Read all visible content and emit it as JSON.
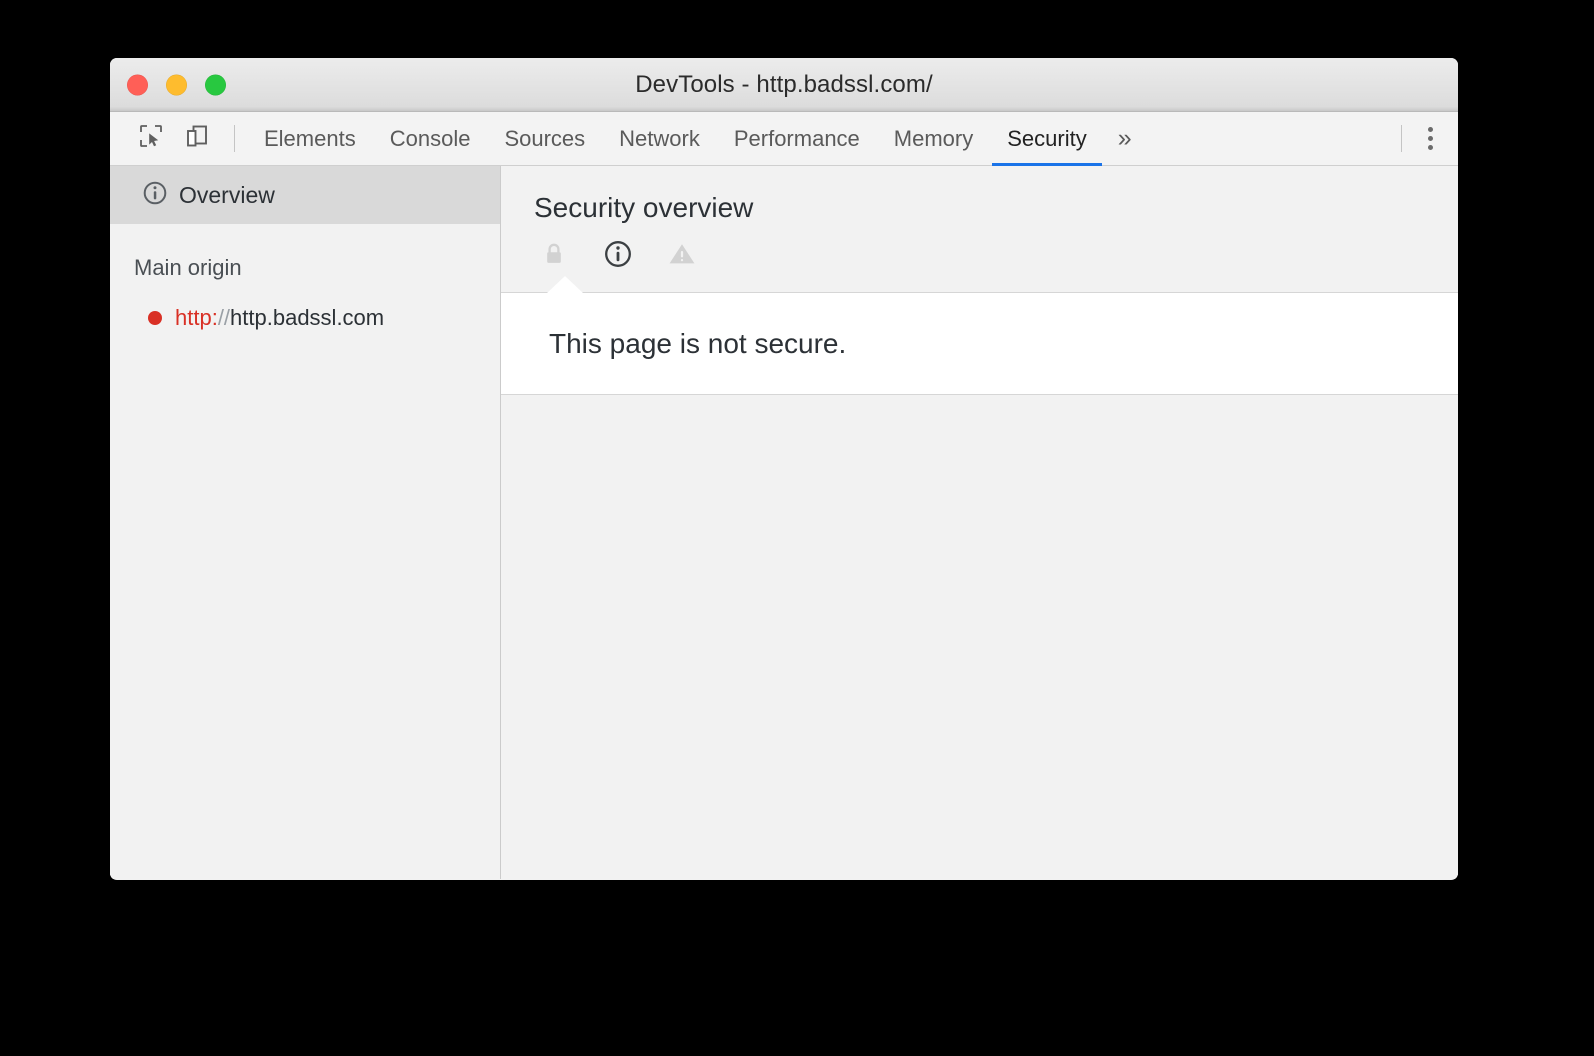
{
  "window": {
    "title": "DevTools - http.badssl.com/",
    "controls": {
      "close": "close-window",
      "minimize": "minimize-window",
      "zoom": "zoom-window"
    }
  },
  "toolbar": {
    "inspect_icon": "inspect-element-icon",
    "device_icon": "device-toolbar-icon",
    "more_tabs_label": "»",
    "menu_icon": "kebab-menu-icon"
  },
  "tabs": [
    {
      "label": "Elements",
      "active": false
    },
    {
      "label": "Console",
      "active": false
    },
    {
      "label": "Sources",
      "active": false
    },
    {
      "label": "Network",
      "active": false
    },
    {
      "label": "Performance",
      "active": false
    },
    {
      "label": "Memory",
      "active": false
    },
    {
      "label": "Security",
      "active": true
    }
  ],
  "sidebar": {
    "overview_item": {
      "label": "Overview",
      "icon": "info-circle-icon",
      "selected": true
    },
    "section_label": "Main origin",
    "origins": [
      {
        "status_color": "#d93025",
        "scheme": "http:",
        "slashes": "//",
        "host": "http.badssl.com"
      }
    ]
  },
  "main": {
    "title": "Security overview",
    "state_icons": [
      {
        "name": "lock-icon",
        "state": "inactive"
      },
      {
        "name": "info-circle-icon",
        "state": "active"
      },
      {
        "name": "warning-triangle-icon",
        "state": "inactive"
      }
    ],
    "summary": "This page is not secure."
  },
  "colors": {
    "accent_blue": "#1a73e8",
    "insecure_red": "#d93025",
    "text_dark": "#2c3136",
    "panel_bg": "#f2f2f2",
    "selected_bg": "#d9d9d9"
  }
}
